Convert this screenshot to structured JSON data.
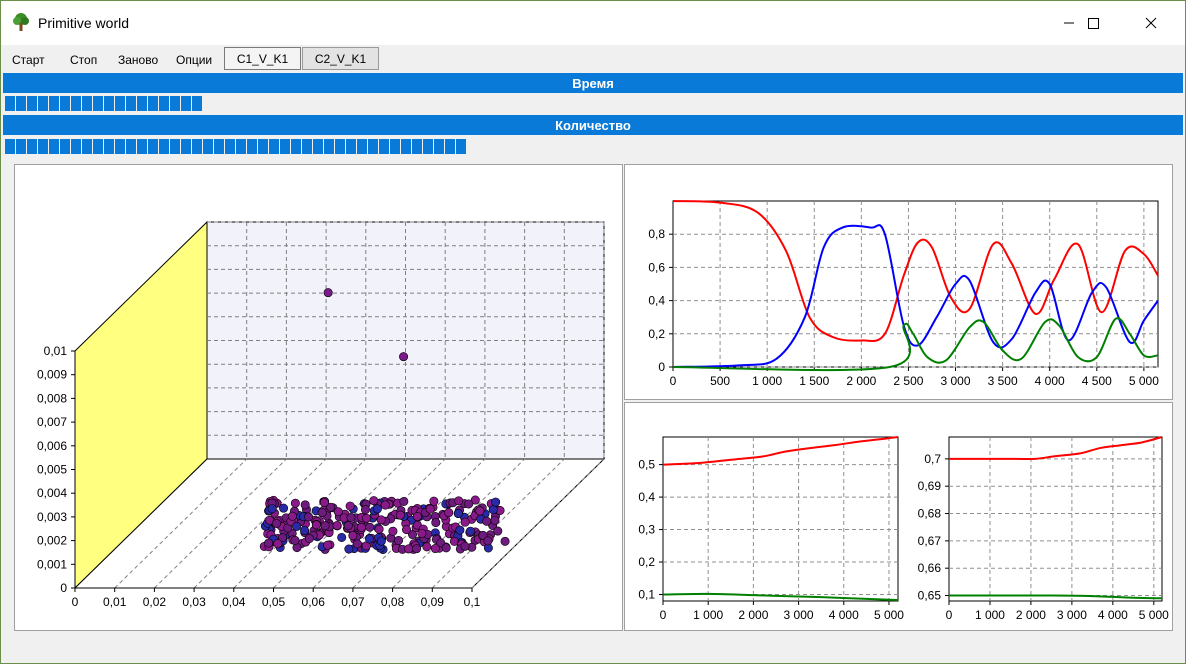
{
  "window": {
    "title": "Primitive world",
    "minimize_icon": "minimize-icon",
    "maximize_icon": "maximize-icon",
    "close_icon": "close-icon",
    "app_icon": "tree-icon"
  },
  "menu": {
    "items": [
      "Старт",
      "Стоп",
      "Заново",
      "Опции"
    ],
    "tabs": [
      "C1_V_K1",
      "C2_V_K1"
    ],
    "active_tab": "C1_V_K1"
  },
  "progress": {
    "time_label": "Время",
    "time_fraction": 0.168,
    "count_label": "Количество",
    "count_fraction": 0.39
  },
  "colors": {
    "accent": "#0a7ad8",
    "red_series": "#ff0000",
    "blue_series": "#0000ff",
    "green_series": "#008000",
    "wall_yellow": "#ffff80",
    "point_purple": "#7a1a8a"
  },
  "chart_data": [
    {
      "type": "scatter",
      "projection": "3d",
      "x_ticks": [
        "0",
        "0,01",
        "0,02",
        "0,03",
        "0,04",
        "0,05",
        "0,06",
        "0,07",
        "0,08",
        "0,09",
        "0,1"
      ],
      "y_ticks": [
        "0",
        "0,001",
        "0,002",
        "0,003",
        "0,004",
        "0,005",
        "0,006",
        "0,007",
        "0,008",
        "0,009",
        "0,01"
      ],
      "xlim": [
        0,
        0.1
      ],
      "ylim": [
        0,
        0.01
      ],
      "grid": true,
      "outliers": [
        {
          "x": 0.062,
          "y": 0.0082
        },
        {
          "x": 0.081,
          "y": 0.0055
        }
      ],
      "cluster": {
        "x_range": [
          0.058,
          0.118
        ],
        "y_range": [
          0.0017,
          0.0038
        ],
        "count": 300
      }
    },
    {
      "type": "line",
      "x_ticks": [
        "0",
        "500",
        "1 000",
        "1 500",
        "2 000",
        "2 500",
        "3 000",
        "3 500",
        "4 000",
        "4 500",
        "5 000"
      ],
      "y_ticks": [
        "0",
        "0,2",
        "0,4",
        "0,6",
        "0,8"
      ],
      "xlim": [
        0,
        5150
      ],
      "ylim": [
        0,
        1
      ],
      "grid": true,
      "series": [
        {
          "color": "red",
          "x": [
            0,
            500,
            900,
            1200,
            1450,
            1700,
            2000,
            2250,
            2450,
            2600,
            2750,
            2950,
            3150,
            3400,
            3600,
            3850,
            4050,
            4300,
            4550,
            4800,
            5000,
            5150
          ],
          "y": [
            1.0,
            0.99,
            0.93,
            0.7,
            0.3,
            0.18,
            0.16,
            0.2,
            0.55,
            0.75,
            0.72,
            0.42,
            0.35,
            0.74,
            0.62,
            0.32,
            0.53,
            0.74,
            0.33,
            0.7,
            0.68,
            0.55
          ]
        },
        {
          "color": "blue",
          "x": [
            0,
            700,
            1100,
            1400,
            1600,
            1800,
            2100,
            2250,
            2450,
            2600,
            2800,
            3000,
            3150,
            3400,
            3600,
            3850,
            4000,
            4200,
            4450,
            4600,
            4850,
            5000,
            5150
          ],
          "y": [
            0.0,
            0.01,
            0.05,
            0.3,
            0.72,
            0.84,
            0.84,
            0.8,
            0.25,
            0.13,
            0.3,
            0.5,
            0.52,
            0.15,
            0.17,
            0.45,
            0.5,
            0.16,
            0.45,
            0.48,
            0.15,
            0.28,
            0.4
          ]
        },
        {
          "color": "green",
          "x": [
            0,
            2300,
            2450,
            2550,
            2700,
            2900,
            3150,
            3300,
            3500,
            3700,
            3950,
            4100,
            4300,
            4500,
            4700,
            4850,
            5000,
            5150
          ],
          "y": [
            0.0,
            0.0,
            0.25,
            0.2,
            0.06,
            0.04,
            0.24,
            0.27,
            0.1,
            0.05,
            0.27,
            0.25,
            0.06,
            0.06,
            0.29,
            0.2,
            0.07,
            0.07
          ]
        }
      ]
    },
    {
      "type": "line",
      "x_ticks": [
        "0",
        "1 000",
        "2 000",
        "3 000",
        "4 000",
        "5 000"
      ],
      "y_ticks": [
        "0,1",
        "0,2",
        "0,3",
        "0,4",
        "0,5"
      ],
      "xlim": [
        0,
        5200
      ],
      "ylim": [
        0.08,
        0.585
      ],
      "grid": true,
      "series": [
        {
          "color": "red",
          "x": [
            0,
            800,
            1500,
            2200,
            2700,
            3200,
            3800,
            4300,
            4800,
            5200
          ],
          "y": [
            0.5,
            0.505,
            0.515,
            0.525,
            0.54,
            0.55,
            0.56,
            0.57,
            0.578,
            0.585
          ]
        },
        {
          "color": "green",
          "x": [
            0,
            1000,
            2000,
            2700,
            3500,
            4200,
            4800,
            5200
          ],
          "y": [
            0.1,
            0.102,
            0.098,
            0.095,
            0.092,
            0.088,
            0.085,
            0.083
          ]
        }
      ]
    },
    {
      "type": "line",
      "x_ticks": [
        "0",
        "1 000",
        "2 000",
        "3 000",
        "4 000",
        "5 000"
      ],
      "y_ticks": [
        "0,65",
        "0,66",
        "0,67",
        "0,68",
        "0,69",
        "0,7"
      ],
      "xlim": [
        0,
        5200
      ],
      "ylim": [
        0.648,
        0.708
      ],
      "grid": true,
      "series": [
        {
          "color": "red",
          "x": [
            0,
            1500,
            2100,
            2600,
            3200,
            3700,
            4200,
            4700,
            5200
          ],
          "y": [
            0.7,
            0.7,
            0.7,
            0.701,
            0.702,
            0.704,
            0.705,
            0.706,
            0.708
          ]
        },
        {
          "color": "green",
          "x": [
            0,
            1500,
            2500,
            3500,
            4500,
            5200
          ],
          "y": [
            0.65,
            0.65,
            0.65,
            0.6498,
            0.6492,
            0.649
          ]
        }
      ]
    }
  ]
}
